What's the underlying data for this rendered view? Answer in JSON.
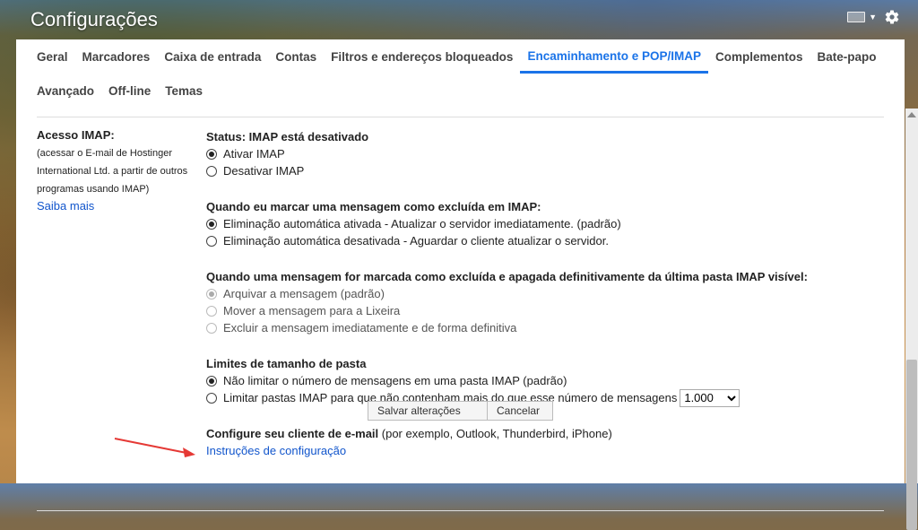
{
  "app": {
    "title": "Configurações"
  },
  "colors": {
    "accent": "#1a73e8",
    "link": "#1155cc"
  },
  "tabs_row1": [
    "Geral",
    "Marcadores",
    "Caixa de entrada",
    "Contas",
    "Filtros e endereços bloqueados",
    "Encaminhamento e POP/IMAP",
    "Complementos",
    "Bate-papo"
  ],
  "tabs_row2": [
    "Avançado",
    "Off-line",
    "Temas"
  ],
  "active_tab": "Encaminhamento e POP/IMAP",
  "left": {
    "label": "Acesso IMAP:",
    "desc1": "(acessar o E-mail de Hostinger",
    "desc2": "International Ltd. a partir de outros",
    "desc3": "programas usando IMAP)",
    "learn_more": "Saiba mais"
  },
  "status": {
    "title": "Status: IMAP está desativado",
    "enable": "Ativar IMAP",
    "disable": "Desativar IMAP",
    "selected": "enable"
  },
  "expunge": {
    "title": "Quando eu marcar uma mensagem como excluída em IMAP:",
    "auto_on": "Eliminação automática ativada - Atualizar o servidor imediatamente. (padrão)",
    "auto_off": "Eliminação automática desativada - Aguardar o cliente atualizar o servidor.",
    "selected": "auto_on"
  },
  "deleted": {
    "title": "Quando uma mensagem for marcada como excluída e apagada definitivamente da última pasta IMAP visível:",
    "archive": "Arquivar a mensagem (padrão)",
    "trash": "Mover a mensagem para a Lixeira",
    "delete": "Excluir a mensagem imediatamente e de forma definitiva",
    "selected": "archive"
  },
  "folder_limits": {
    "title": "Limites de tamanho de pasta",
    "no_limit": "Não limitar o número de mensagens em uma pasta IMAP (padrão)",
    "limit": "Limitar pastas IMAP para que não contenham mais do que esse número de mensagens",
    "limit_value": "1.000",
    "selected": "no_limit"
  },
  "client": {
    "title": "Configure seu cliente de e-mail",
    "examples": " (por exemplo, Outlook, Thunderbird, iPhone)",
    "instructions": "Instruções de configuração"
  },
  "buttons": {
    "save": "Salvar alterações",
    "cancel": "Cancelar"
  },
  "icons": {
    "keyboard": "keyboard-icon",
    "settings": "gear-icon",
    "annotation": "red-arrow-icon"
  }
}
